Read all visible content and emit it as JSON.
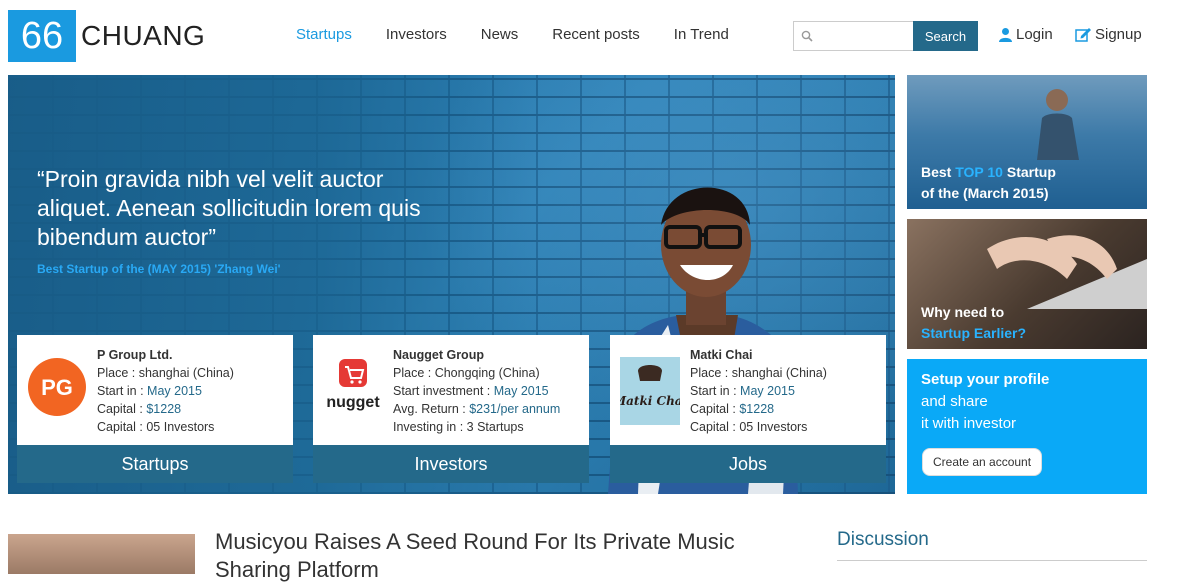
{
  "logo": {
    "number": "66",
    "text": "CHUANG"
  },
  "nav": [
    {
      "label": "Startups",
      "active": true
    },
    {
      "label": "Investors",
      "active": false
    },
    {
      "label": "News",
      "active": false
    },
    {
      "label": "Recent posts",
      "active": false
    },
    {
      "label": "In Trend",
      "active": false
    }
  ],
  "search": {
    "placeholder": "",
    "button": "Search"
  },
  "auth": {
    "login": "Login",
    "signup": "Signup"
  },
  "hero": {
    "quote": "“Proin gravida nibh vel velit auctor aliquet. Aenean sollicitudin lorem quis bibendum auctor”",
    "subtitle": "Best Startup of the (MAY 2015) 'Zhang Wei'"
  },
  "cards": [
    {
      "logo_text": "PG",
      "title": "P Group Ltd.",
      "rows": [
        {
          "label": "Place : ",
          "value": "shanghai (China)",
          "highlight": false
        },
        {
          "label": "Start in : ",
          "value": "May 2015",
          "highlight": true
        },
        {
          "label": "Capital : ",
          "value": "$1228",
          "highlight": true
        },
        {
          "label": "Capital : ",
          "value": "05 Investors",
          "highlight": false
        }
      ],
      "footer": "Startups"
    },
    {
      "logo_text": "nugget",
      "title": "Naugget Group",
      "rows": [
        {
          "label": "Place : ",
          "value": "Chongqing (China)",
          "highlight": false
        },
        {
          "label": "Start investment : ",
          "value": "May 2015",
          "highlight": true
        },
        {
          "label": "Avg. Return : ",
          "value": "$231/per annum",
          "highlight": true
        },
        {
          "label": "Investing in : ",
          "value": "3 Startups",
          "highlight": false
        }
      ],
      "footer": "Investors"
    },
    {
      "logo_text": "Matki Chai",
      "title": "Matki Chai",
      "rows": [
        {
          "label": "Place : ",
          "value": "shanghai (China)",
          "highlight": false
        },
        {
          "label": "Start in : ",
          "value": "May 2015",
          "highlight": true
        },
        {
          "label": "Capital : ",
          "value": "$1228",
          "highlight": true
        },
        {
          "label": "Capital : ",
          "value": "05 Investors",
          "highlight": false
        }
      ],
      "footer": "Jobs"
    }
  ],
  "side": {
    "panel1": {
      "line1_pre": "Best ",
      "line1_hl": "TOP 10",
      "line1_post": " Startup",
      "line2": "of the (March 2015)"
    },
    "panel2": {
      "line1": "Why need to",
      "line2": "Startup Earlier?"
    },
    "panel3": {
      "line1": "Setup your profile",
      "line2": "and share",
      "line3": "it with investor",
      "button": "Create an account"
    }
  },
  "article": {
    "title": "Musicyou Raises A Seed Round For Its Private Music Sharing Platform"
  },
  "sidebar": {
    "discussion": "Discussion"
  },
  "colors": {
    "accent": "#1a9ae0",
    "dark_teal": "#24698a",
    "cyan_panel": "#0aa9f7"
  }
}
